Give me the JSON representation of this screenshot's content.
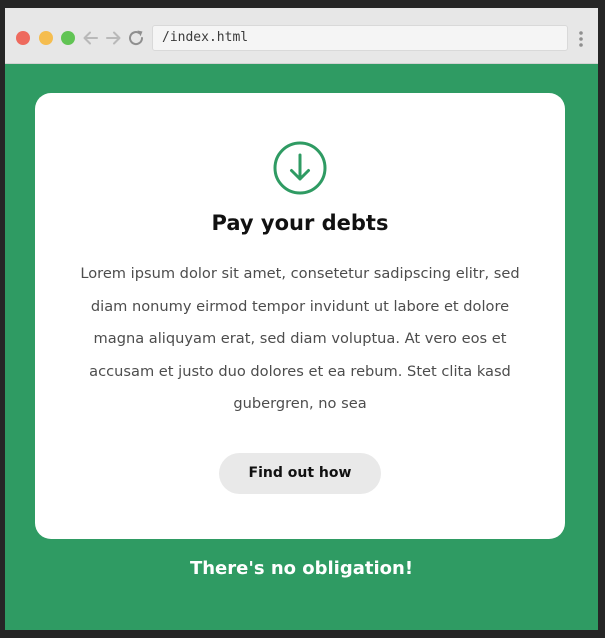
{
  "browser": {
    "url": "/index.html",
    "traffic_lights": [
      "close",
      "minimize",
      "maximize"
    ],
    "icons": {
      "back": "arrow-left-icon",
      "forward": "arrow-right-icon",
      "reload": "reload-icon",
      "menu": "kebab-menu-icon"
    }
  },
  "colors": {
    "page_background": "#2f9b63",
    "card_background": "#ffffff",
    "accent": "#2f9b63",
    "button_background": "#e9e9e9"
  },
  "card": {
    "icon": "arrow-down-circle-icon",
    "title": "Pay your debts",
    "body": "Lorem ipsum dolor sit amet, consetetur sadipscing elitr, sed diam nonumy eirmod tempor invidunt ut labore et dolore magna aliquyam erat, sed diam voluptua. At vero eos et accusam et justo duo dolores et ea rebum. Stet clita kasd gubergren, no sea",
    "button_label": "Find out how"
  },
  "footer": {
    "note": "There's no obligation!"
  }
}
